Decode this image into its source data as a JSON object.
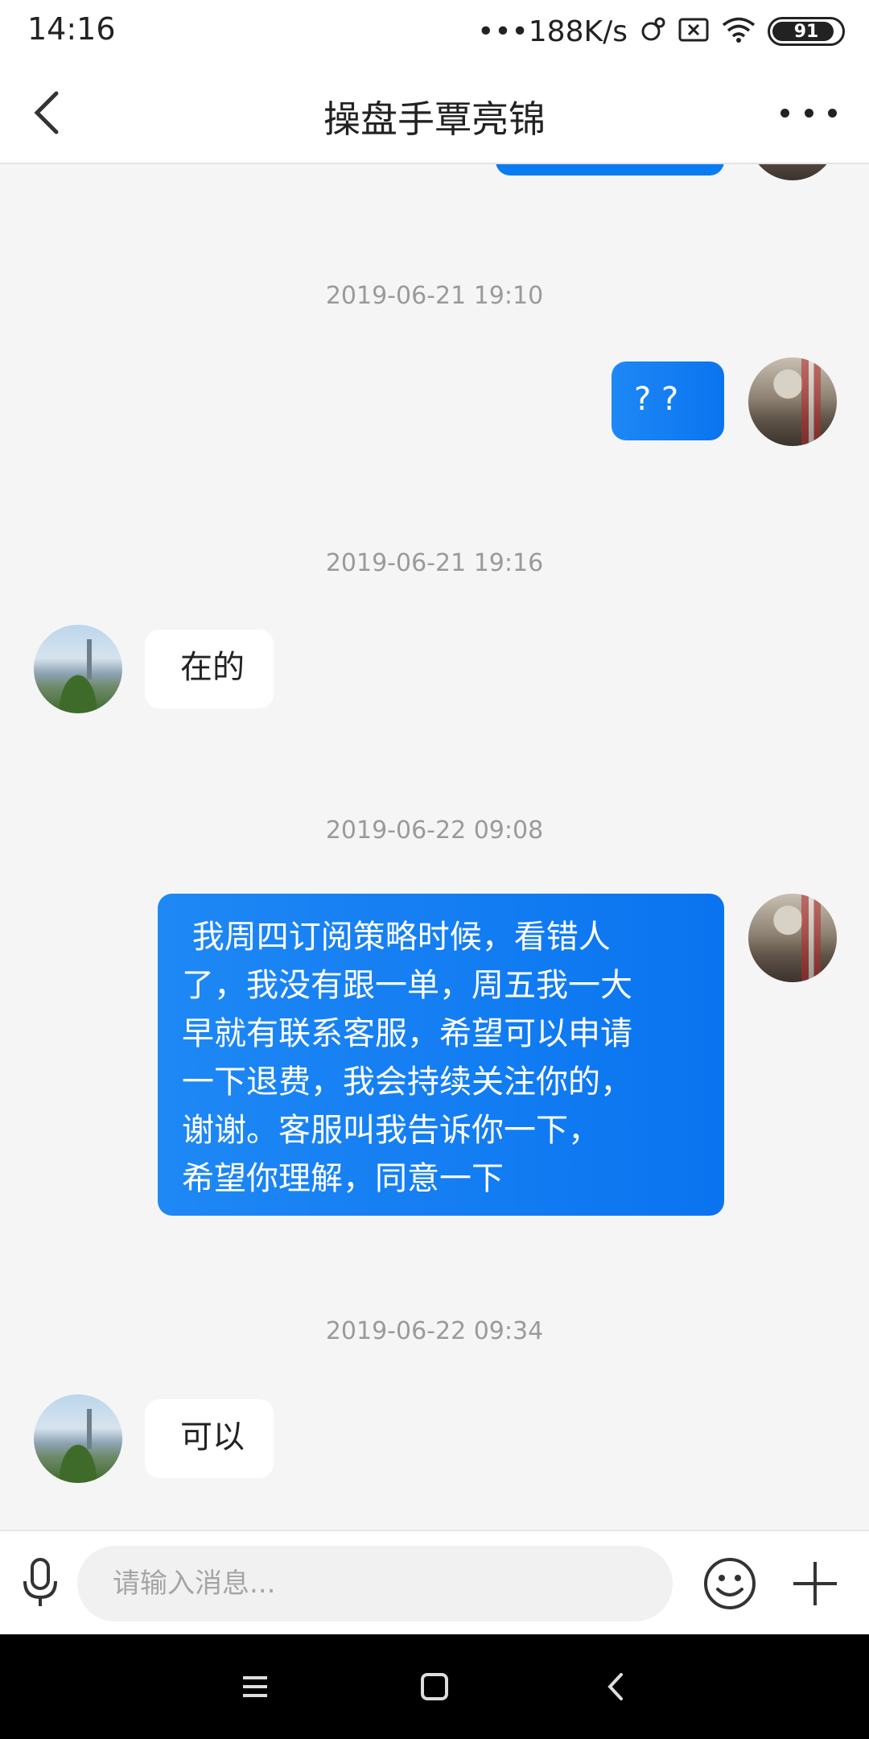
{
  "status_bar": {
    "time": "14:16",
    "network_speed": "•••188K/s",
    "battery": "91"
  },
  "header": {
    "title": "操盘手覃亮锦"
  },
  "messages": [
    {
      "timestamp": "2019-06-21 19:10",
      "from": "me",
      "lines": [
        "? ?"
      ]
    },
    {
      "timestamp": "2019-06-21 19:16",
      "from": "other",
      "lines": [
        "在的"
      ]
    },
    {
      "timestamp": "2019-06-22 09:08",
      "from": "me",
      "lines": [
        " 我周四订阅策略时候，看错人",
        "了，我没有跟一单，周五我一大",
        "早就有联系客服，希望可以申请",
        "一下退费，我会持续关注你的，",
        "谢谢。客服叫我告诉你一下，",
        "希望你理解，同意一下"
      ]
    },
    {
      "timestamp": "2019-06-22 09:34",
      "from": "other",
      "lines": [
        "可以"
      ]
    }
  ],
  "input": {
    "placeholder": "请输入消息..."
  },
  "colors": {
    "bubble_me": "#0a7cf2",
    "bubble_other": "#ffffff",
    "background": "#f5f5f5"
  },
  "icons": [
    "back-arrow-icon",
    "more-dots-icon",
    "microphone-icon",
    "emoji-icon",
    "plus-icon",
    "menu-icon",
    "home-square-icon",
    "back-triangle-icon"
  ]
}
